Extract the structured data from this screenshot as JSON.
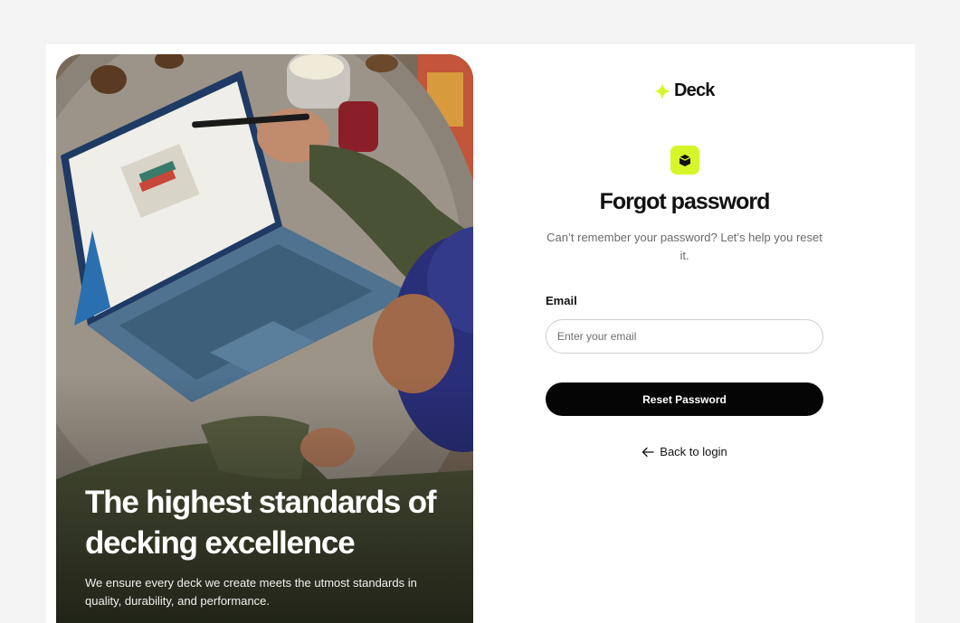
{
  "brand": {
    "name": "Deck",
    "accent_color": "#d8f52a",
    "logo_icon": "sparkle-star-icon"
  },
  "hero": {
    "title": "The highest standards of decking excellence",
    "subtitle": "We ensure every deck we create meets the utmost standards in quality, durability, and performance.",
    "image": "person-using-laptop-with-stylus-photo"
  },
  "form": {
    "badge_icon": "box-icon",
    "title": "Forgot password",
    "subtitle": "Can’t remember your password? Let’s help you reset it.",
    "email_label": "Email",
    "email_placeholder": "Enter your email",
    "submit_label": "Reset Password",
    "back_icon": "arrow-left-icon",
    "back_label": "Back to login"
  }
}
